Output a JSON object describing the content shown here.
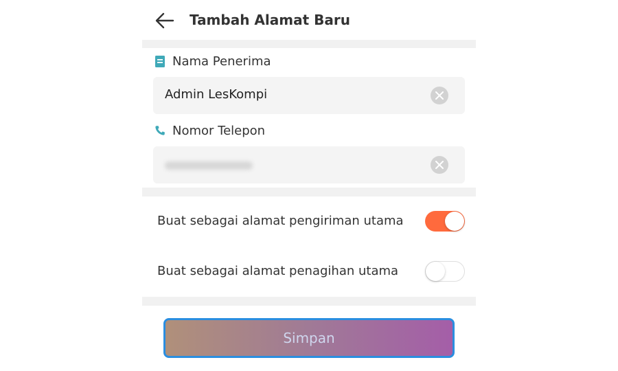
{
  "header": {
    "title": "Tambah Alamat Baru",
    "back_icon": "arrow-left-icon"
  },
  "form": {
    "recipient": {
      "label": "Nama Penerima",
      "icon": "document-icon",
      "value": "Admin LesKompi",
      "clear_icon": "clear-icon"
    },
    "phone": {
      "label": "Nomor Telepon",
      "icon": "phone-icon",
      "value_hidden": true,
      "clear_icon": "clear-icon"
    }
  },
  "toggles": [
    {
      "label": "Buat sebagai alamat pengiriman utama",
      "on": true
    },
    {
      "label": "Buat sebagai alamat penagihan utama",
      "on": false
    }
  ],
  "colors": {
    "accent": "#ff6a3d",
    "label_icon": "#3fa9b8",
    "button_border": "#2a8ee0"
  },
  "actions": {
    "save_label": "Simpan"
  }
}
